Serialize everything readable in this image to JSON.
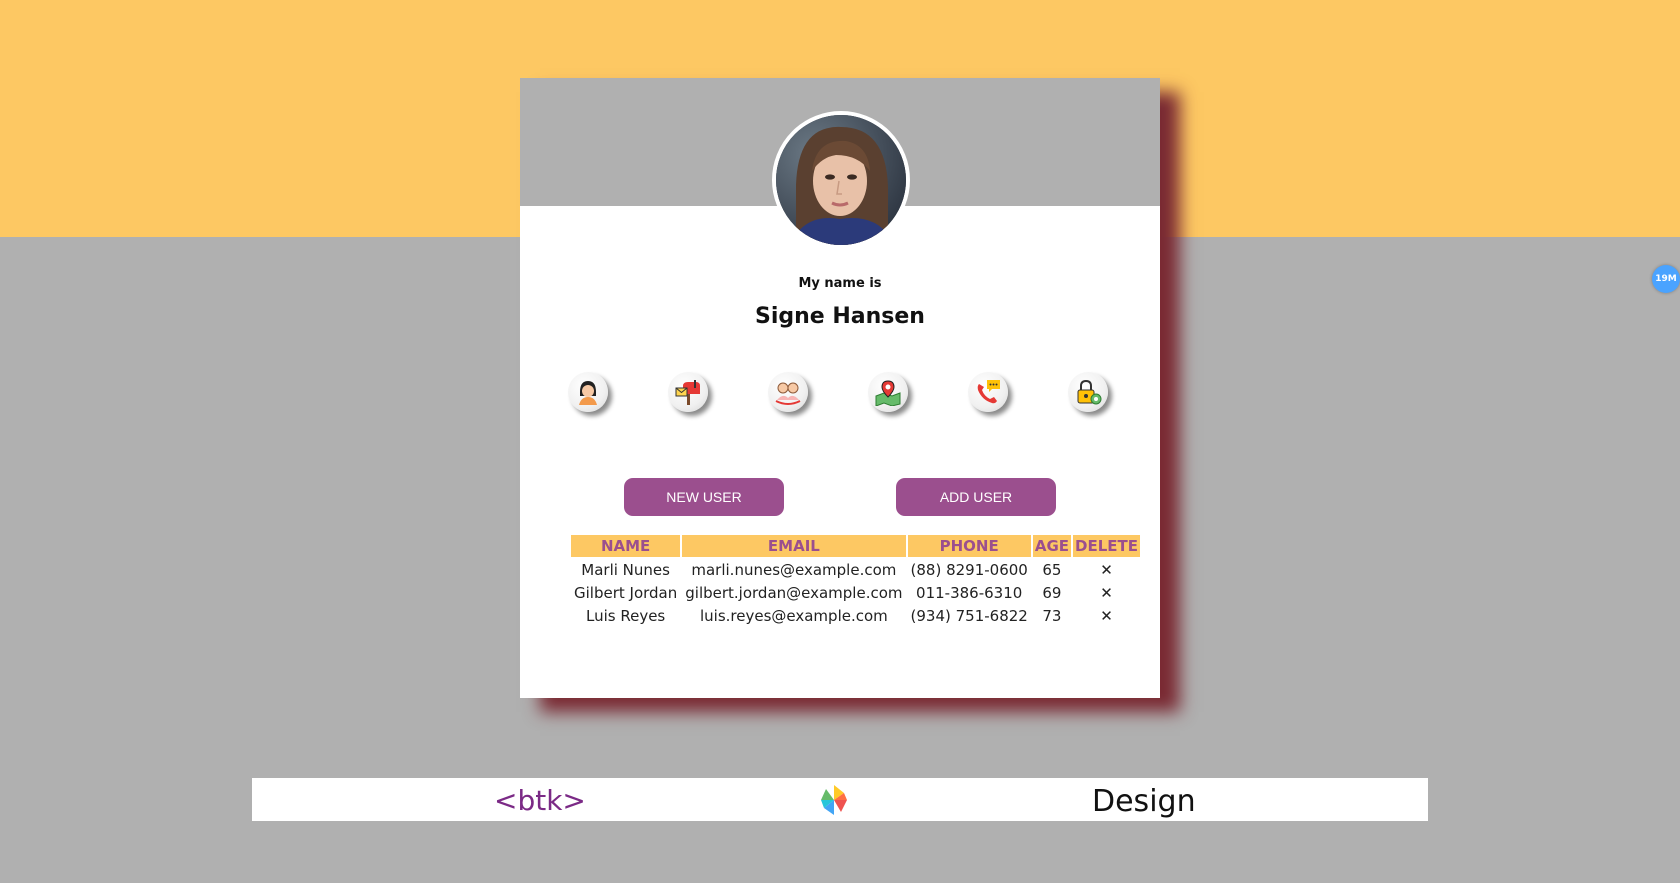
{
  "profile": {
    "caption": "My name is",
    "name": "Signe Hansen"
  },
  "icons": [
    {
      "name": "person-icon"
    },
    {
      "name": "mailbox-icon"
    },
    {
      "name": "birthday-icon"
    },
    {
      "name": "location-icon"
    },
    {
      "name": "phone-icon"
    },
    {
      "name": "password-icon"
    }
  ],
  "buttons": {
    "new_user": "NEW USER",
    "add_user": "ADD USER"
  },
  "table": {
    "headers": [
      "NAME",
      "EMAIL",
      "PHONE",
      "AGE",
      "DELETE"
    ],
    "rows": [
      {
        "name": "Marli Nunes",
        "email": "marli.nunes@example.com",
        "phone": "(88) 8291-0600",
        "age": "65",
        "delete": "✕"
      },
      {
        "name": "Gilbert Jordan",
        "email": "gilbert.jordan@example.com",
        "phone": "011-386-6310",
        "age": "69",
        "delete": "✕"
      },
      {
        "name": "Luis Reyes",
        "email": "luis.reyes@example.com",
        "phone": "(934) 751-6822",
        "age": "73",
        "delete": "✕"
      }
    ]
  },
  "footer": {
    "brand": "<btk>",
    "design": "Design"
  },
  "badge": {
    "text": "19M"
  },
  "colors": {
    "accent": "#9b4f8e",
    "band": "#fdc863",
    "background": "#b0b0b0",
    "shadow": "#7a2a33"
  }
}
